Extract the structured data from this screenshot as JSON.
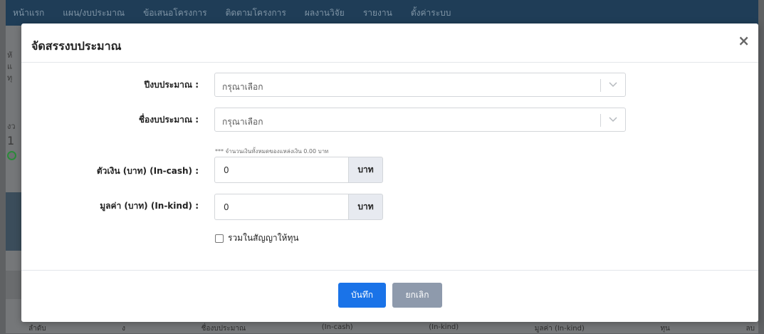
{
  "background": {
    "nav_items": [
      "หน้าแรก",
      "แผน/งบประมาณ",
      "ข้อเสนอโครงการ",
      "ติดตามโครงการ",
      "ผลงานวิจัย",
      "รายงาน",
      "ตั้งค่าระบบ"
    ],
    "side_texts": [
      "หั",
      "แ",
      "ทุ",
      "งว",
      "1"
    ],
    "bottom_texts": [
      "ลำดับ",
      "ง",
      "ชื่องบประมาณ",
      "(In-cash)",
      "(In-kind)",
      "มูลค่า (In-kind)",
      "ทุน",
      "ลบ"
    ]
  },
  "modal": {
    "title": "จัดสรรงบประมาณ",
    "close_symbol": "×",
    "fiscal_year": {
      "label": "ปีงบประมาณ :",
      "placeholder": "กรุณาเลือก"
    },
    "budget_name": {
      "label": "ชื่องบประมาณ :",
      "placeholder": "กรุณาเลือก"
    },
    "hint": "*** จำนวนเงินทั้งหมดของแหล่งเงิน 0.00 บาท",
    "in_cash": {
      "label": "ตัวเงิน (บาท) (In-cash) :",
      "value": "0",
      "unit": "บาท"
    },
    "in_kind": {
      "label": "มูลค่า (บาท) (In-kind) :",
      "value": "0",
      "unit": "บาท"
    },
    "include_checkbox": {
      "label": "รวมในสัญญาให้ทุน",
      "checked": false
    },
    "save_label": "บันทึก",
    "cancel_label": "ยกเลิก"
  },
  "colors": {
    "primary": "#1a73e8",
    "secondary": "#8e9aac",
    "addon_bg": "#e7eaf0"
  }
}
